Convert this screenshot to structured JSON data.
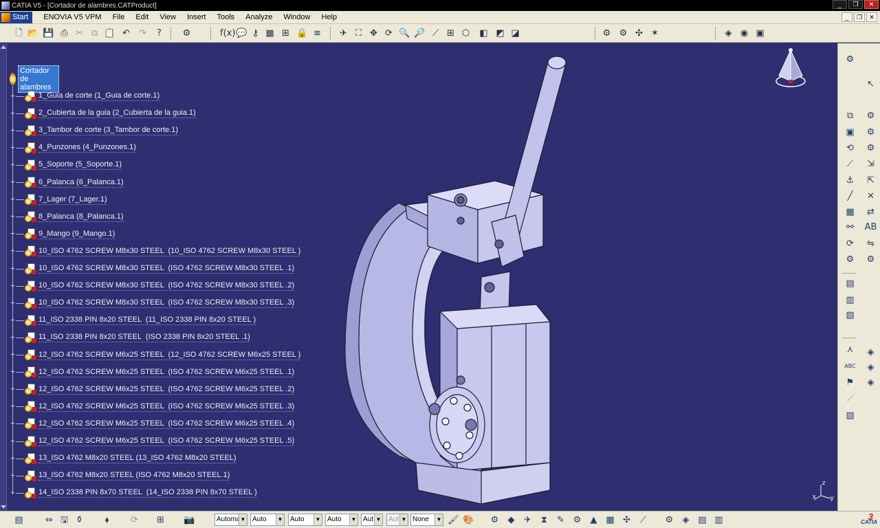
{
  "window": {
    "title": "CATIA V5 - [Cortador de alambres.CATProduct]",
    "buttons": [
      "_",
      "❐",
      "✕"
    ]
  },
  "menu": {
    "start": "Start",
    "items": [
      "ENOVIA V5 VPM",
      "File",
      "Edit",
      "View",
      "Insert",
      "Tools",
      "Analyze",
      "Window",
      "Help"
    ]
  },
  "tree": {
    "root": "Cortador de alambres",
    "items": [
      "1_Guia de corte (1_Guia de corte.1)",
      "2_Cubierta de la guia (2_Cubierta de la guia.1)",
      "3_Tambor de corte (3_Tambor de corte.1)",
      "4_Punzones (4_Punzones.1)",
      "5_Soporte (5_Soporte.1)",
      "6_Palanca (6_Palanca.1)",
      "7_Lager (7_Lager.1)",
      "8_Palanca (8_Palanca.1)",
      "9_Mango (9_Mango.1)",
      "10_ISO 4762 SCREW M8x30 STEEL  (10_ISO 4762 SCREW M8x30 STEEL )",
      "10_ISO 4762 SCREW M8x30 STEEL  (ISO 4762 SCREW M8x30 STEEL .1)",
      "10_ISO 4762 SCREW M8x30 STEEL  (ISO 4762 SCREW M8x30 STEEL .2)",
      "10_ISO 4762 SCREW M8x30 STEEL  (ISO 4762 SCREW M8x30 STEEL .3)",
      "11_ISO 2338 PIN 8x20 STEEL  (11_ISO 2338 PIN 8x20 STEEL )",
      "11_ISO 2338 PIN 8x20 STEEL  (ISO 2338 PIN 8x20 STEEL .1)",
      "12_ISO 4762 SCREW M6x25 STEEL  (12_ISO 4762 SCREW M6x25 STEEL )",
      "12_ISO 4762 SCREW M6x25 STEEL  (ISO 4762 SCREW M6x25 STEEL .1)",
      "12_ISO 4762 SCREW M6x25 STEEL  (ISO 4762 SCREW M6x25 STEEL .2)",
      "12_ISO 4762 SCREW M6x25 STEEL  (ISO 4762 SCREW M6x25 STEEL .3)",
      "12_ISO 4762 SCREW M6x25 STEEL  (ISO 4762 SCREW M6x25 STEEL .4)",
      "12_ISO 4762 SCREW M6x25 STEEL  (ISO 4762 SCREW M6x25 STEEL .5)",
      "13_ISO 4762 M8x20 STEEL (13_ISO 4762 M8x20 STEEL)",
      "13_ISO 4762 M8x20 STEEL (ISO 4762 M8x20 STEEL.1)",
      "14_ISO 2338 PIN 8x70 STEEL  (14_ISO 2338 PIN 8x70 STEEL )"
    ]
  },
  "triad": {
    "z": "z",
    "x": "x",
    "y": "y"
  },
  "bottom": {
    "combos": [
      "Automa",
      "Auto",
      "Auto",
      "Auto",
      "Aut",
      "Aut",
      "None"
    ],
    "logo": "CATIA"
  },
  "colors": {
    "background": "#2e2e70",
    "part_fill": "#c9c9ee",
    "selection": "#3478d0"
  }
}
